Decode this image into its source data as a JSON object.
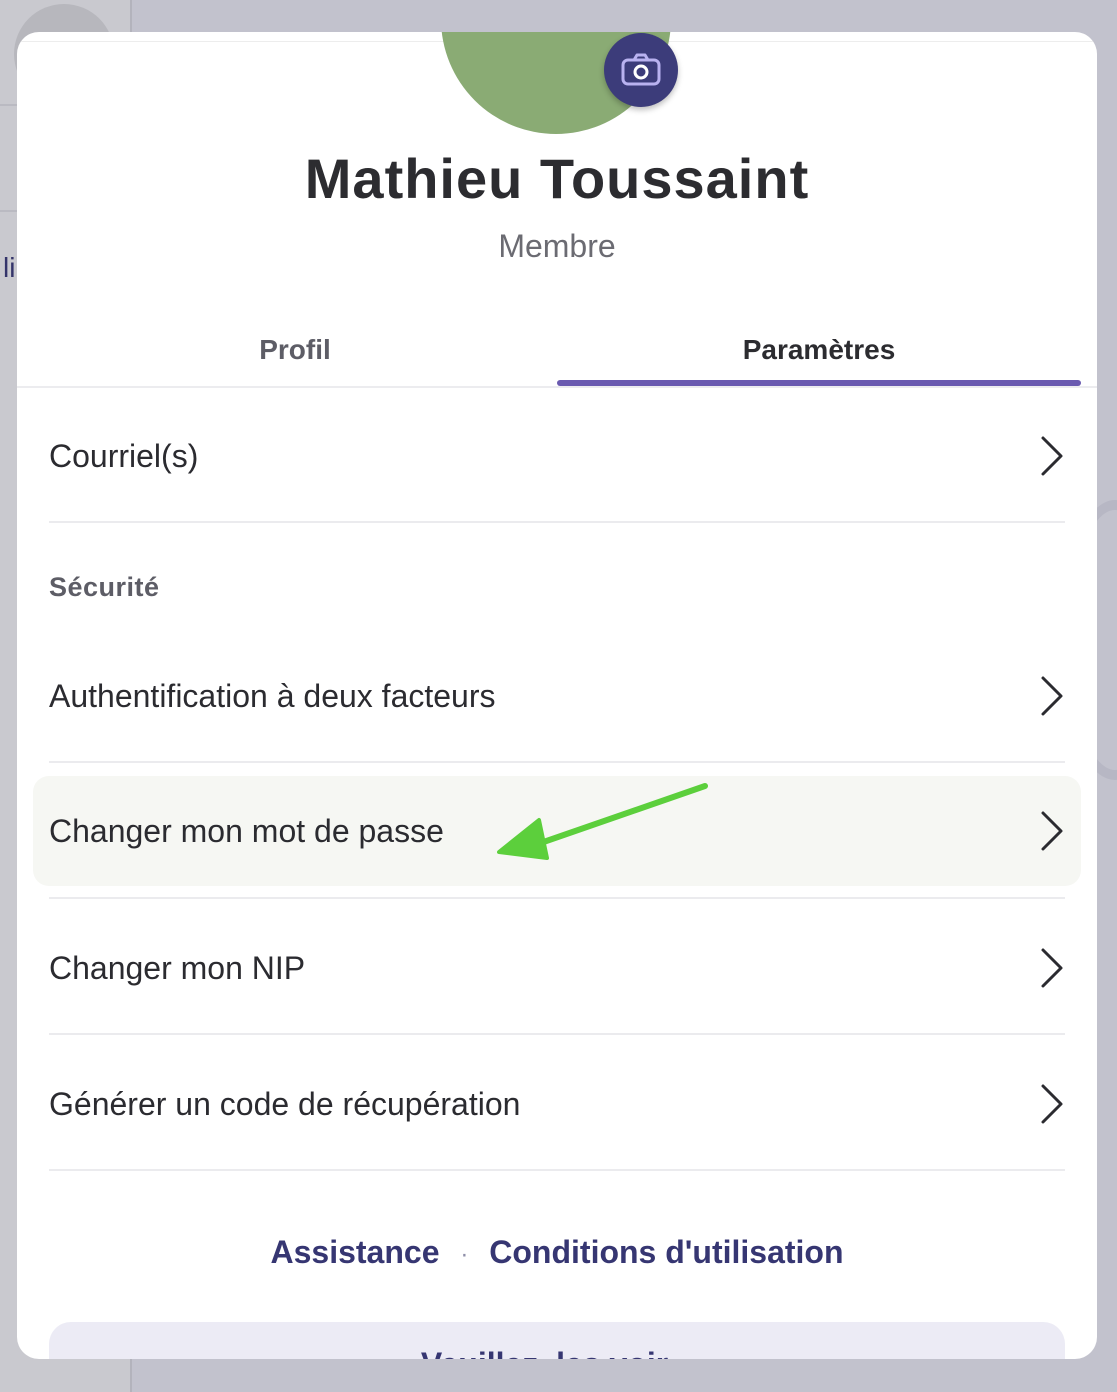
{
  "background": {
    "partial_letter": "li"
  },
  "profile": {
    "name": "Mathieu Toussaint",
    "role": "Membre",
    "camera_icon": "camera-icon",
    "avatar_color": "#8aab74"
  },
  "tabs": [
    {
      "label": "Profil",
      "active": false
    },
    {
      "label": "Paramètres",
      "active": true
    }
  ],
  "accent_color": "#6a5ab0",
  "settings": {
    "email_label": "Courriel(s)",
    "security_title": "Sécurité",
    "items": [
      {
        "label": "Authentification à deux facteurs"
      },
      {
        "label": "Changer mon mot de passe",
        "highlighted": true
      },
      {
        "label": "Changer mon NIP"
      },
      {
        "label": "Générer un code de récupération"
      }
    ]
  },
  "annotation": {
    "arrow_color": "#5ccf3c",
    "points_to": "Changer mon mot de passe"
  },
  "footer": {
    "support_link": "Assistance",
    "separator": "·",
    "terms_link": "Conditions d'utilisation"
  },
  "bottom_button": {
    "label": "Veuillez, les voir..."
  }
}
